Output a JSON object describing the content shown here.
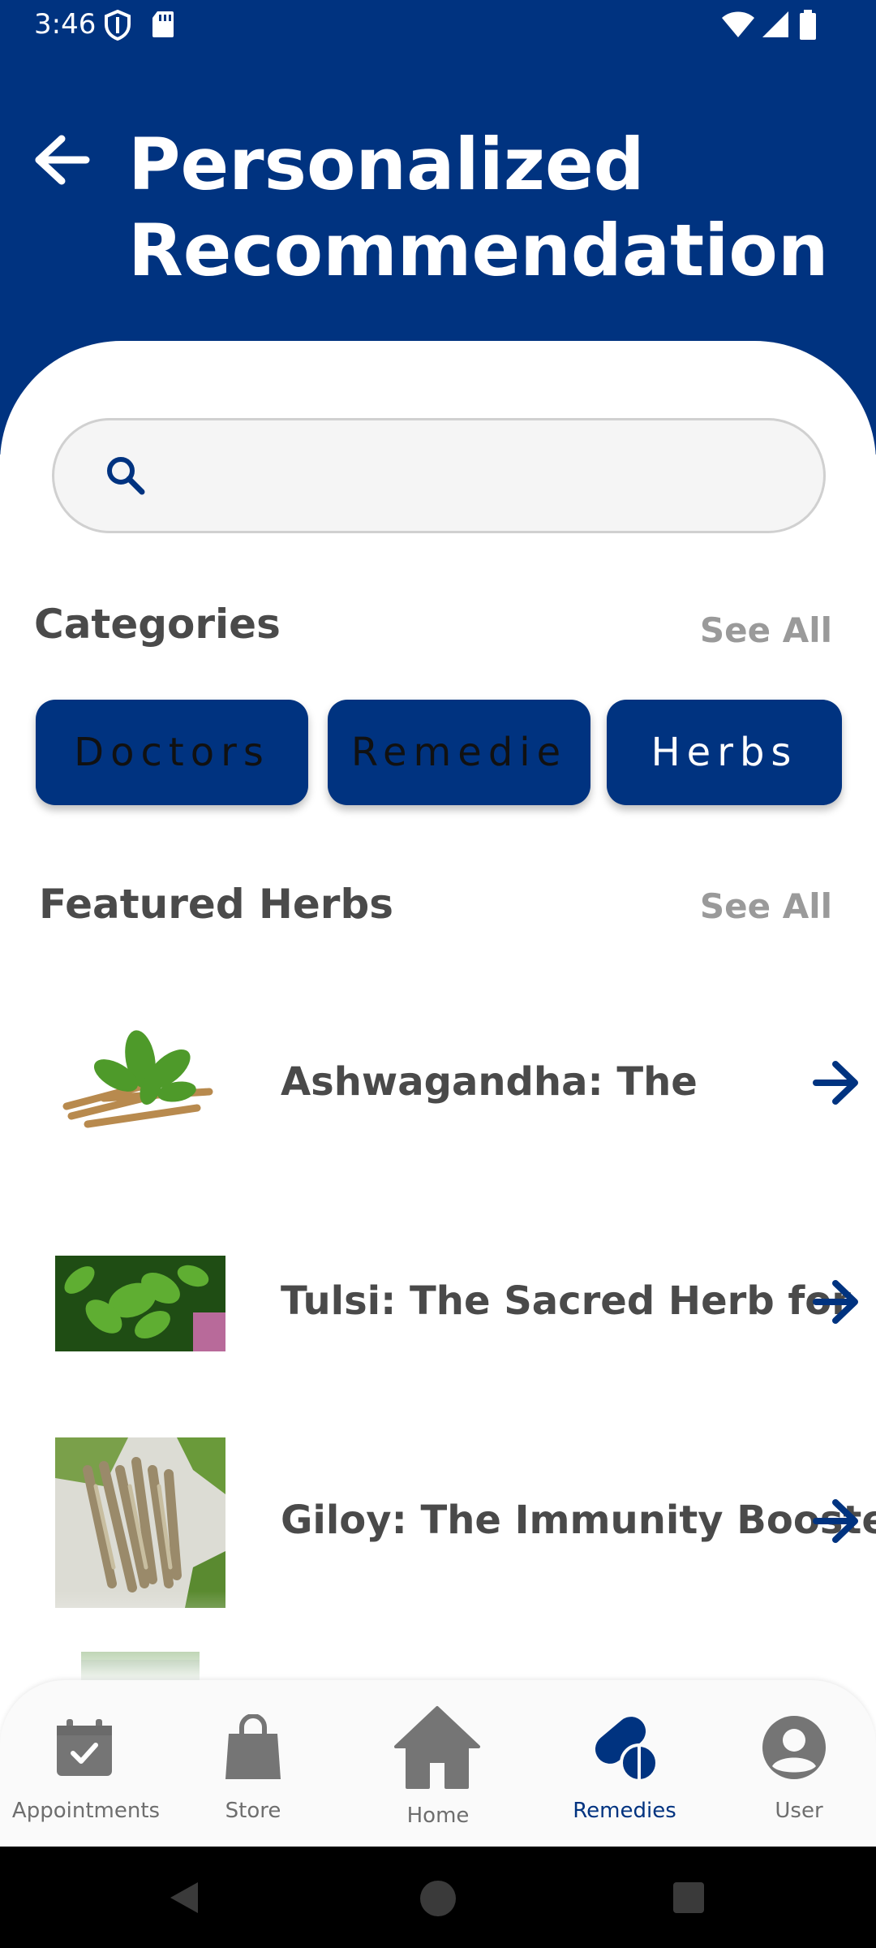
{
  "status_bar": {
    "time": "3:46"
  },
  "header": {
    "title_line1": "Personalized",
    "title_line2": "Recommendation"
  },
  "search": {
    "placeholder": ""
  },
  "categories": {
    "title": "Categories",
    "see_all": "See All",
    "chips": [
      {
        "label": "Doctors",
        "text_color": "#111111"
      },
      {
        "label": "Remedie",
        "text_color": "#111111"
      },
      {
        "label": "Herbs",
        "text_color": "#ffffff"
      }
    ]
  },
  "featured": {
    "title": "Featured Herbs",
    "see_all": "See All",
    "items": [
      {
        "title": "Ashwagandha: The",
        "icon": "arrow-right-icon"
      },
      {
        "title": "Tulsi: The Sacred Herb for",
        "icon": "arrow-right-icon"
      },
      {
        "title": "Giloy: The Immunity Booster",
        "icon": "arrow-right-icon"
      }
    ]
  },
  "bottom_nav": {
    "items": [
      {
        "label": "Appointments",
        "icon": "calendar-check-icon",
        "active": false
      },
      {
        "label": "Store",
        "icon": "shopping-bag-icon",
        "active": false
      },
      {
        "label": "Home",
        "icon": "home-icon",
        "active": false
      },
      {
        "label": "Remedies",
        "icon": "pills-icon",
        "active": true
      },
      {
        "label": "User",
        "icon": "account-circle-icon",
        "active": false
      }
    ]
  },
  "colors": {
    "primary": "#003380",
    "text_dark": "#4a4a4a",
    "text_muted": "#9a9a9a",
    "nav_inactive": "#6e6e6e"
  }
}
